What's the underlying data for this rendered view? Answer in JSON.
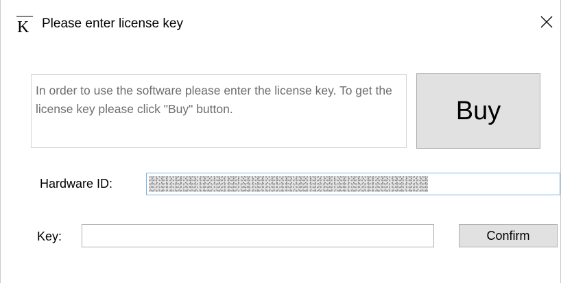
{
  "window": {
    "title": "Please enter license key",
    "icon": "k-logo-icon"
  },
  "info": {
    "message": "In order to use the software please enter the license key. To get the license key please click \"Buy\" button."
  },
  "buttons": {
    "buy_label": "Buy",
    "confirm_label": "Confirm"
  },
  "hardware": {
    "label": "Hardware ID:",
    "value_redacted": true
  },
  "key": {
    "label": "Key:",
    "value": ""
  },
  "colors": {
    "button_bg": "#e1e1e1",
    "button_border": "#adadad",
    "focus_border": "#7ab4e6",
    "info_text": "#6d6d6d"
  }
}
